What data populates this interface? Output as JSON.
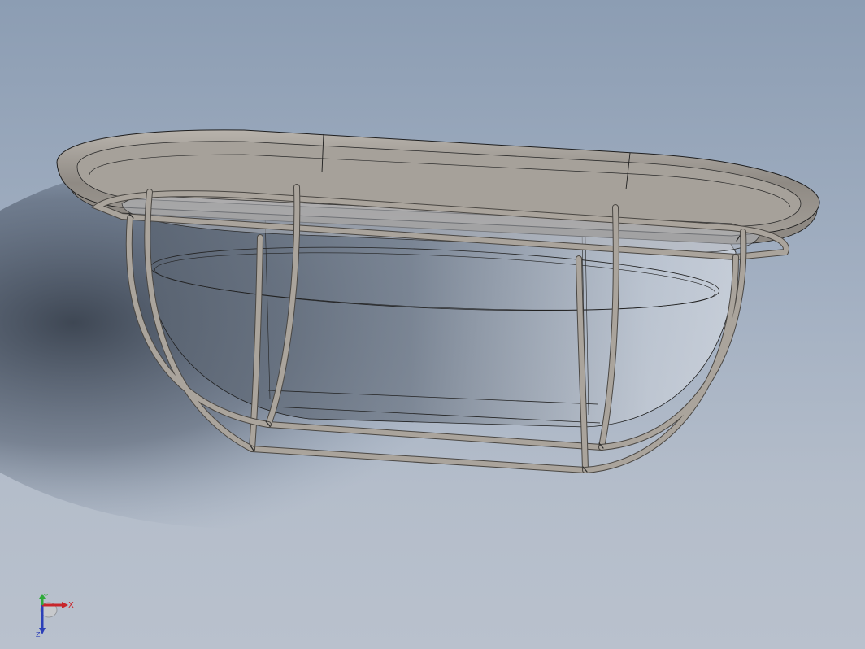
{
  "viewport": {
    "background_top": "#8c9db3",
    "background_bottom": "#b9c1cd",
    "model": {
      "body_color": "#9a958f",
      "body_edge": "#2a2a2a",
      "glass_color": "#c9d0da",
      "cage_color": "#aaa49c"
    }
  },
  "triad": {
    "x_label": "X",
    "y_label": "Y",
    "z_label": "Z",
    "x_color": "#c8262b",
    "y_color": "#2eaa3a",
    "z_color": "#2b3fb8"
  }
}
